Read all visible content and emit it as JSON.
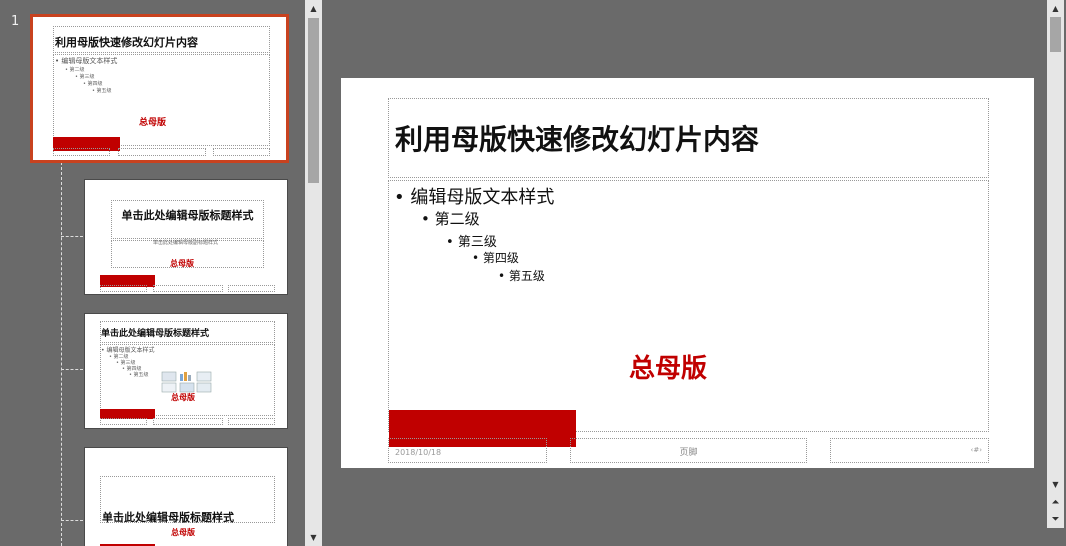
{
  "thumbnails": {
    "slide_number": "1",
    "master": {
      "title": "利用母版快速修改幻灯片内容",
      "levels": [
        "编辑母版文本样式",
        "第二级",
        "第三级",
        "第四级",
        "第五级"
      ],
      "label": "总母版"
    },
    "layout1": {
      "title": "单击此处编辑母版标题样式",
      "subtitle": "单击此处编辑母版副标题样式",
      "label": "总母版"
    },
    "layout2": {
      "title": "单击此处编辑母版标题样式",
      "levels": [
        "编辑母版文本样式",
        "第二级",
        "第三级",
        "第四级",
        "第五级"
      ],
      "label": "总母版"
    },
    "layout3": {
      "title": "单击此处编辑母版标题样式",
      "label": "总母版"
    }
  },
  "slide": {
    "title": "利用母版快速修改幻灯片内容",
    "levels": [
      "编辑母版文本样式",
      "第二级",
      "第三级",
      "第四级",
      "第五级"
    ],
    "label": "总母版",
    "footer": {
      "date": "2018/10/18",
      "text": "页脚",
      "page": "‹#›"
    }
  },
  "colors": {
    "accent_red": "#c00000",
    "selection": "#c8421f",
    "background": "#6a6a6a"
  },
  "icons": {
    "scroll_up": "▲",
    "scroll_down": "▼",
    "prev_slide": "⏶",
    "next_slide": "⏷"
  }
}
